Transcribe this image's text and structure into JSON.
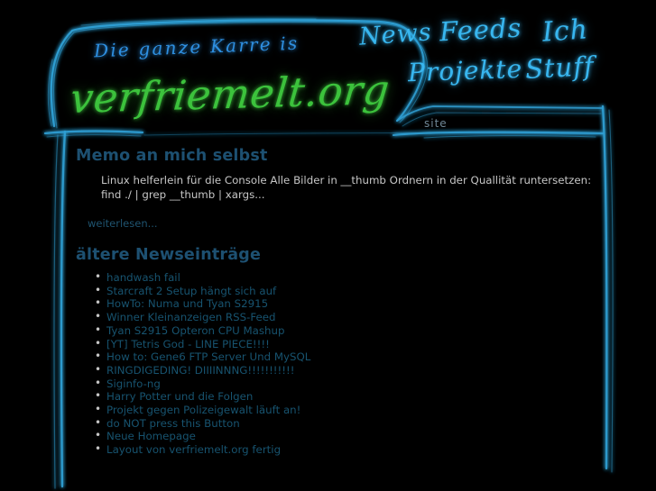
{
  "header": {
    "tagline": "Die ganze Karre is",
    "sitename": "verfriemelt.org",
    "nav": [
      {
        "key": "news",
        "label": "News"
      },
      {
        "key": "feeds",
        "label": "Feeds"
      },
      {
        "key": "ich",
        "label": "Ich"
      },
      {
        "key": "projekte",
        "label": "Projekte"
      },
      {
        "key": "stuff",
        "label": "Stuff"
      }
    ],
    "search": {
      "placeholder": "site",
      "value": ""
    }
  },
  "main": {
    "post": {
      "title": "Memo an mich selbst",
      "body": "Linux helferlein für die Console Alle Bilder in __thumb Ordnern in der Quallität runtersetzen: find ./ | grep __thumb | xargs...",
      "readmore": "weiterlesen..."
    },
    "archive": {
      "title": "ältere Newseinträge",
      "items": [
        "handwash fail",
        "Starcraft 2 Setup hängt sich auf",
        "HowTo: Numa und Tyan S2915",
        "Winner Kleinanzeigen RSS-Feed",
        "Tyan S2915 Opteron CPU Mashup",
        "[YT] Tetris God - LINE PIECE!!!!",
        "How to: Gene6 FTP Server Und MySQL",
        "RINGDIGEDING! DIIIINNNG!!!!!!!!!!!",
        "Siginfo-ng",
        "Harry Potter und die Folgen",
        "Projekt gegen Polizeigewalt läuft an!",
        "do NOT press this Button",
        "Neue Homepage",
        "Layout von verfriemelt.org fertig"
      ]
    }
  },
  "colors": {
    "background": "#000000",
    "frame_line": "#2f9fd4",
    "sitename_green": "#3cc23c",
    "tagline_blue": "#2e8fe0",
    "heading_blue": "#1d5071",
    "link_blue": "#17536f",
    "body_text": "#c6c6c6"
  }
}
